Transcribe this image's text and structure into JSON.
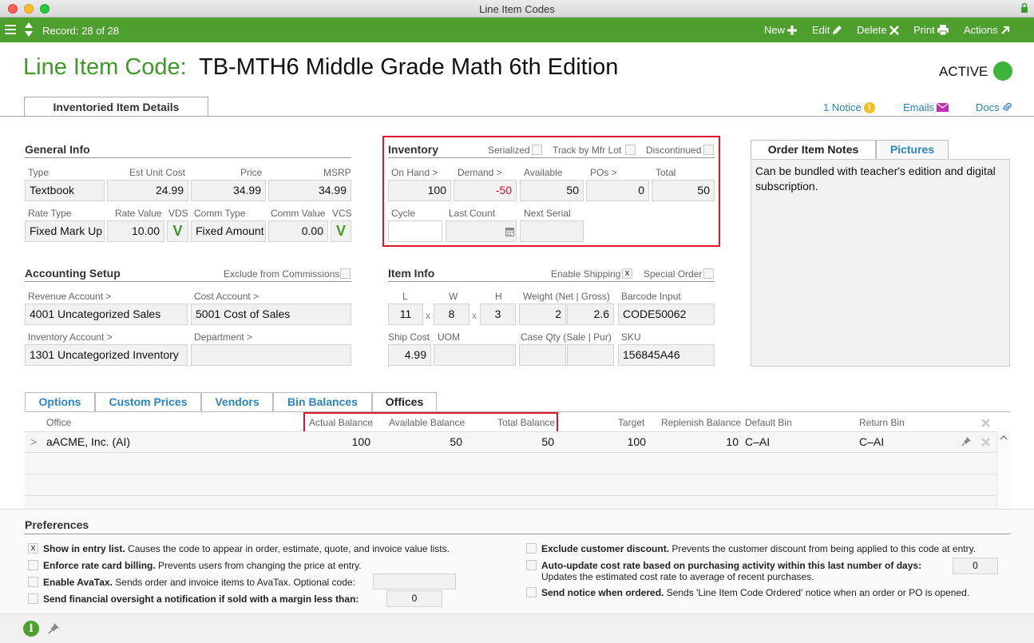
{
  "window": {
    "title": "Line Item Codes"
  },
  "toolbar": {
    "record": "Record: 28 of 28",
    "new": "New",
    "edit": "Edit",
    "delete": "Delete",
    "print": "Print",
    "actions": "Actions"
  },
  "header": {
    "label": "Line Item Code:",
    "name": "TB-MTH6 Middle Grade Math 6th Edition",
    "status": "ACTIVE",
    "status_color": "#3db53a"
  },
  "tabs": {
    "main": "Inventoried Item Details"
  },
  "links": {
    "notice": "1 Notice",
    "emails": "Emails",
    "docs": "Docs"
  },
  "general": {
    "title": "General Info",
    "type_lbl": "Type",
    "type": "Textbook",
    "est_lbl": "Est Unit Cost",
    "est": "24.99",
    "price_lbl": "Price",
    "price": "34.99",
    "msrp_lbl": "MSRP",
    "msrp": "34.99",
    "ratetype_lbl": "Rate Type",
    "ratetype": "Fixed Mark Up",
    "ratevalue_lbl": "Rate Value",
    "ratevalue": "10.00",
    "vds_lbl": "VDS",
    "vds": "V",
    "commtype_lbl": "Comm Type",
    "commtype": "Fixed Amount",
    "commvalue_lbl": "Comm Value",
    "commvalue": "0.00",
    "vcs_lbl": "VCS",
    "vcs": "V"
  },
  "inventory": {
    "title": "Inventory",
    "serialized": "Serialized",
    "track": "Track by Mfr Lot",
    "discontinued": "Discontinued",
    "onhand_lbl": "On Hand >",
    "onhand": "100",
    "demand_lbl": "Demand >",
    "demand": "-50",
    "available_lbl": "Available",
    "available": "50",
    "pos_lbl": "POs >",
    "pos": "0",
    "total_lbl": "Total",
    "total": "50",
    "cycle_lbl": "Cycle",
    "lastcount_lbl": "Last Count",
    "nextserial_lbl": "Next Serial"
  },
  "notes": {
    "tab1": "Order Item Notes",
    "tab2": "Pictures",
    "body": "Can be bundled with teacher's edition and digital subscription."
  },
  "accounting": {
    "title": "Accounting Setup",
    "exclude": "Exclude from Commissions",
    "revenue_lbl": "Revenue Account >",
    "revenue": "4001 Uncategorized Sales",
    "cost_lbl": "Cost Account >",
    "cost": "5001 Cost of Sales",
    "inv_lbl": "Inventory Account >",
    "inv": "1301 Uncategorized Inventory",
    "dept_lbl": "Department >"
  },
  "iteminfo": {
    "title": "Item Info",
    "shipping": "Enable Shipping",
    "shipping_checked": "x",
    "special": "Special Order",
    "l_lbl": "L",
    "l": "11",
    "w_lbl": "W",
    "w": "8",
    "h_lbl": "H",
    "h": "3",
    "x": "x",
    "weight_lbl": "Weight (Net | Gross)",
    "weight_net": "2",
    "weight_gross": "2.6",
    "barcode_lbl": "Barcode Input",
    "barcode": "CODE50062",
    "shipcost_lbl": "Ship Cost",
    "shipcost": "4.99",
    "uom_lbl": "UOM",
    "caseqty_lbl": "Case Qty (Sale | Pur)",
    "sku_lbl": "SKU",
    "sku": "156845A46"
  },
  "lowertabs": [
    "Options",
    "Custom Prices",
    "Vendors",
    "Bin Balances",
    "Offices"
  ],
  "offices": {
    "headers": {
      "office": "Office",
      "actual": "Actual Balance",
      "available": "Available Balance",
      "total": "Total Balance",
      "target": "Target",
      "replenish": "Replenish Balance",
      "defaultbin": "Default Bin",
      "returnbin": "Return Bin"
    },
    "rows": [
      {
        "expand": ">",
        "office": "aACME, Inc.  (AI)",
        "actual": "100",
        "available": "50",
        "total": "50",
        "target": "100",
        "replenish": "10",
        "defaultbin": "C–AI",
        "returnbin": "C–AI"
      }
    ]
  },
  "prefs": {
    "title": "Preferences",
    "p1_b": "Show in entry list.",
    "p1": " Causes the code to appear in order, estimate, quote, and invoice value lists.",
    "p1_check": "x",
    "p2_b": "Enforce rate card billing.",
    "p2": " Prevents users from changing the price at entry.",
    "p3_b": "Enable AvaTax.",
    "p3": " Sends order and invoice items to AvaTax. Optional code:",
    "p4_b": "Send financial oversight a notification if sold with a margin less than:",
    "p4_val": "0",
    "p5_b": "Exclude customer discount.",
    "p5": " Prevents the customer discount from being applied to this code at entry.",
    "p6_b": "Auto-update cost rate based on purchasing activity within this last number of days:",
    "p6_val": "0",
    "p6_sub": "Updates the estimated cost rate to average of recent purchases.",
    "p7_b": "Send notice when ordered.",
    "p7": " Sends 'Line Item Code Ordered' notice when an order or PO is opened."
  }
}
